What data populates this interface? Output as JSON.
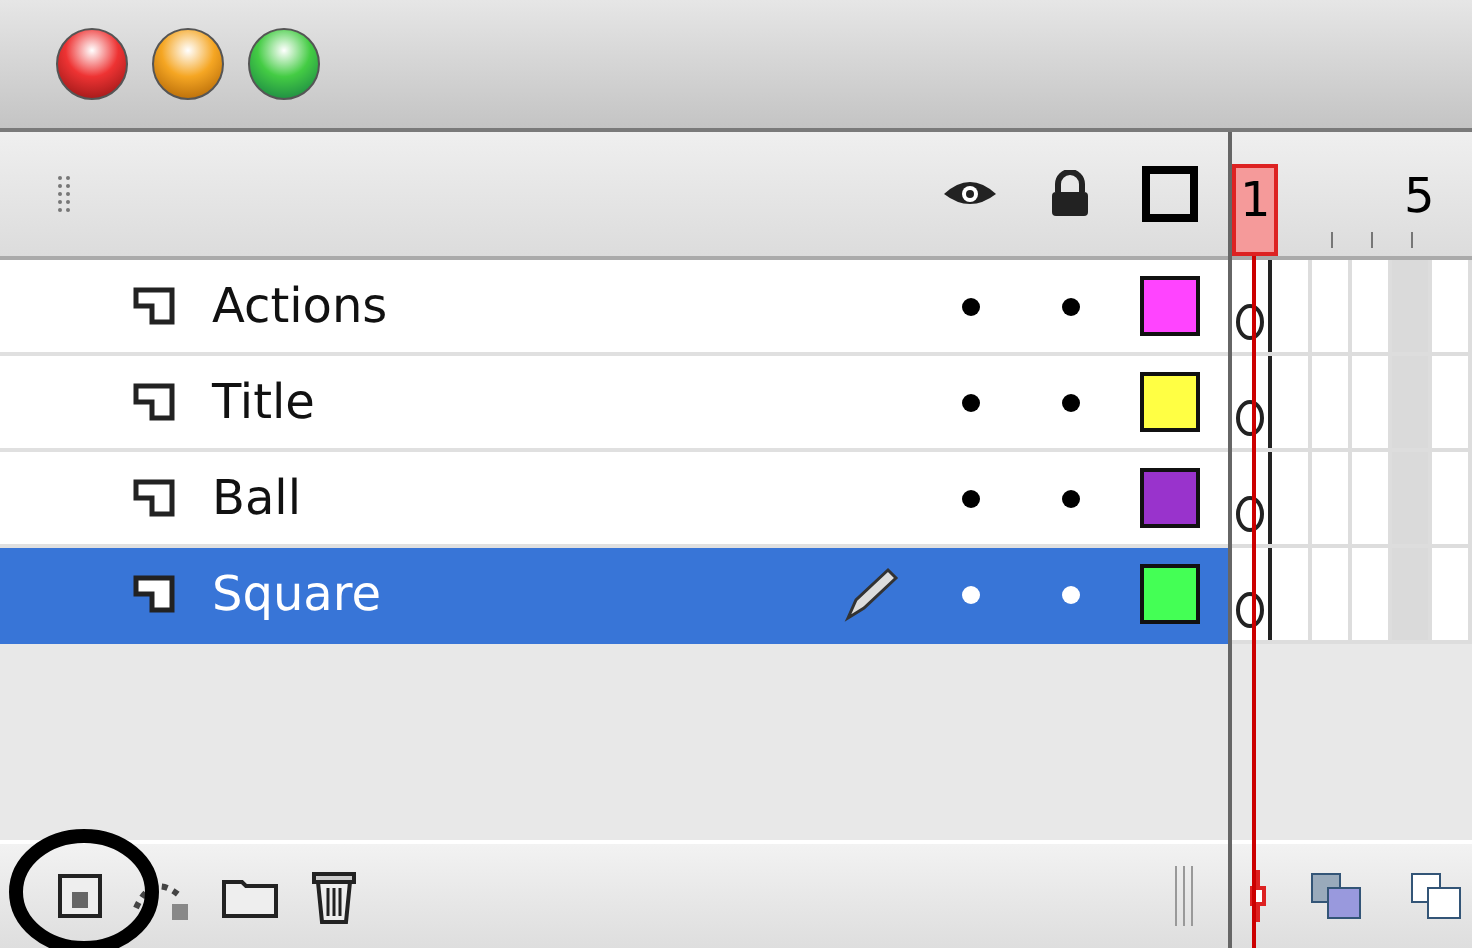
{
  "timeline": {
    "frame_numbers": [
      {
        "label": "1",
        "current": true
      },
      {
        "label": "5",
        "current": false
      }
    ],
    "layers": [
      {
        "name": "Actions",
        "selected": false,
        "visible": true,
        "locked": false,
        "color": "#ff44ff"
      },
      {
        "name": "Title",
        "selected": false,
        "visible": true,
        "locked": false,
        "color": "#ffff44"
      },
      {
        "name": "Ball",
        "selected": false,
        "visible": true,
        "locked": false,
        "color": "#9933cc"
      },
      {
        "name": "Square",
        "selected": true,
        "visible": true,
        "locked": false,
        "color": "#44ff55"
      }
    ]
  }
}
